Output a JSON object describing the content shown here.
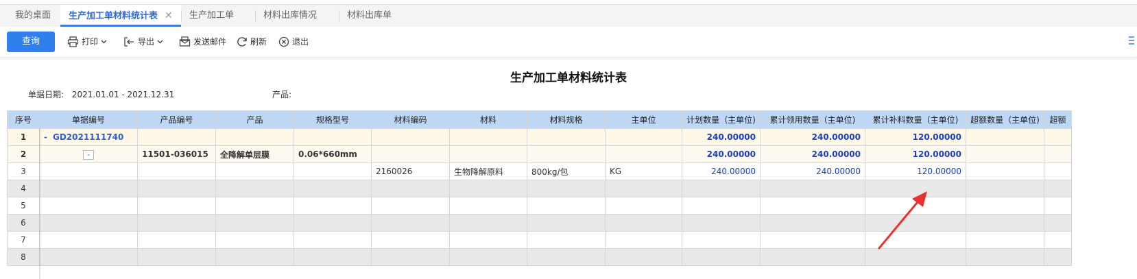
{
  "tabs": [
    {
      "label": "我的桌面",
      "active": false
    },
    {
      "label": "生产加工单材料统计表",
      "active": true,
      "closable": true
    },
    {
      "label": "生产加工单",
      "active": false
    },
    {
      "label": "材料出库情况",
      "active": false
    },
    {
      "label": "材料出库单",
      "active": false
    }
  ],
  "toolbar": {
    "query_label": "查询",
    "print_label": "打印",
    "export_label": "导出",
    "email_label": "发送邮件",
    "refresh_label": "刷新",
    "exit_label": "退出"
  },
  "report": {
    "title": "生产加工单材料统计表",
    "date_label": "单据日期:",
    "date_value": "2021.01.01 - 2021.12.31",
    "product_label": "产品:"
  },
  "table": {
    "headers": [
      "序号",
      "单据编号",
      "产品编号",
      "产品",
      "规格型号",
      "材料编码",
      "材料",
      "材料规格",
      "主单位",
      "计划数量（主单位)",
      "累计领用数量（主单位)",
      "累计补料数量（主单位)",
      "超额数量（主单位)",
      "超额"
    ],
    "rows": [
      {
        "no": "1",
        "doc": "GD2021111740",
        "product_code": "",
        "product": "",
        "spec": "",
        "mat_code": "",
        "material": "",
        "mat_spec": "",
        "unit": "",
        "plan": "240.00000",
        "used": "240.00000",
        "supplement": "120.00000",
        "excess": ""
      },
      {
        "no": "2",
        "doc": "",
        "product_code": "11501-036015",
        "product": "全降解单层膜",
        "spec": "0.06*660mm",
        "mat_code": "",
        "material": "",
        "mat_spec": "",
        "unit": "",
        "plan": "240.00000",
        "used": "240.00000",
        "supplement": "120.00000",
        "excess": ""
      },
      {
        "no": "3",
        "doc": "",
        "product_code": "",
        "product": "",
        "spec": "",
        "mat_code": "2160026",
        "material": "生物降解原料",
        "mat_spec": "800kg/包",
        "unit": "KG",
        "plan": "240.00000",
        "used": "240.00000",
        "supplement": "120.00000",
        "excess": ""
      },
      {
        "no": "4"
      },
      {
        "no": "5"
      },
      {
        "no": "6"
      },
      {
        "no": "7"
      },
      {
        "no": "8"
      }
    ]
  },
  "colors": {
    "accent": "#2f80ed",
    "header_bg": "#bdd7f5",
    "level1_bg": "#fff8e6",
    "number_blue": "#1a3fc0",
    "annotation": "#e8342e"
  }
}
